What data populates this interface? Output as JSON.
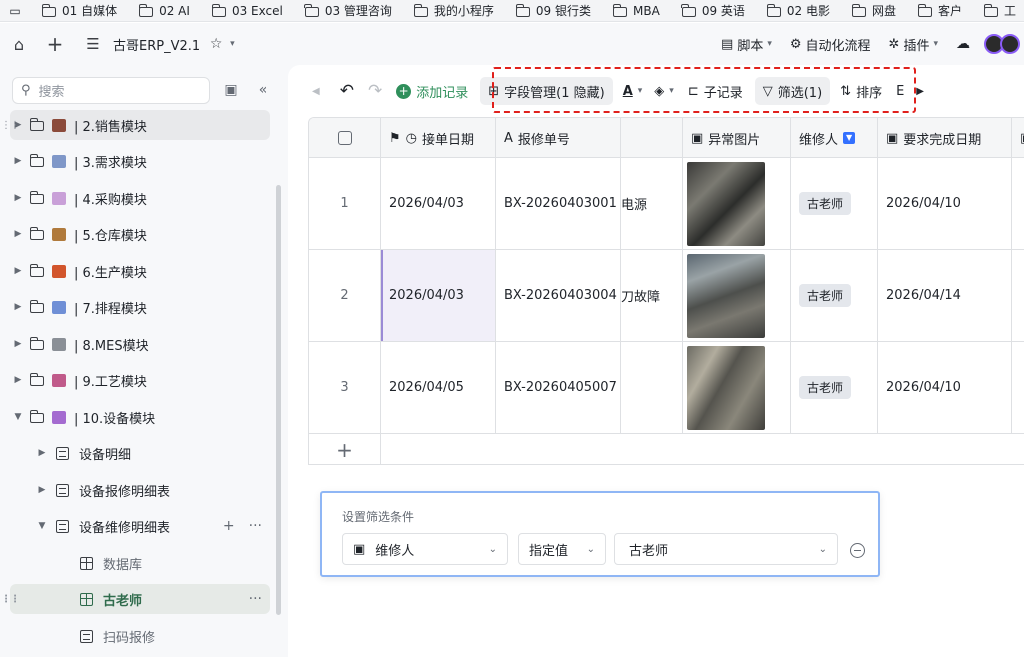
{
  "bookmarks": [
    "01 自媒体",
    "02 AI",
    "03 Excel",
    "03 管理咨询",
    "我的小程序",
    "09 银行类",
    "MBA",
    "09 英语",
    "02 电影",
    "网盘",
    "客户",
    "工"
  ],
  "app": {
    "title": "古哥ERP_V2.1",
    "header_buttons": {
      "script": "脚本",
      "automation": "自动化流程",
      "plugins": "插件"
    }
  },
  "sidebar": {
    "search_placeholder": "搜索",
    "modules": [
      {
        "label": "| 2.销售模块",
        "color": "#8b4a3a"
      },
      {
        "label": "| 3.需求模块",
        "color": "#7f97c8"
      },
      {
        "label": "| 4.采购模块",
        "color": "#c9a0d8"
      },
      {
        "label": "| 5.仓库模块",
        "color": "#b07a3c"
      },
      {
        "label": "| 6.生产模块",
        "color": "#d2552c"
      },
      {
        "label": "| 7.排程模块",
        "color": "#6f8fd6"
      },
      {
        "label": "| 8.MES模块",
        "color": "#8a8f96"
      },
      {
        "label": "| 9.工艺模块",
        "color": "#c05a8a"
      },
      {
        "label": "| 10.设备模块",
        "color": "#a46bd0"
      }
    ],
    "children": [
      "设备明细",
      "设备报修明细表",
      "设备维修明细表"
    ],
    "views": [
      "数据库",
      "古老师"
    ],
    "last_item": "扫码报修"
  },
  "toolbar": {
    "add_record": "添加记录",
    "field_mgmt": "字段管理(1 隐藏)",
    "sub_record": "子记录",
    "filter": "筛选(1)",
    "sort": "排序"
  },
  "table": {
    "headers": [
      "接单日期",
      "报修单号",
      "",
      "异常图片",
      "维修人",
      "要求完成日期"
    ],
    "rows": [
      {
        "no": "1",
        "date": "2026/04/03",
        "order": "BX-20260403001",
        "desc": "电源",
        "person": "古老师",
        "due": "2026/04/10"
      },
      {
        "no": "2",
        "date": "2026/04/03",
        "order": "BX-20260403004",
        "desc": "刀故障",
        "person": "古老师",
        "due": "2026/04/14"
      },
      {
        "no": "3",
        "date": "2026/04/05",
        "order": "BX-20260405007",
        "desc": "",
        "person": "古老师",
        "due": "2026/04/10"
      }
    ]
  },
  "filter_panel": {
    "title": "设置筛选条件",
    "field": "维修人",
    "operator": "指定值",
    "value": "古老师"
  },
  "colors": {
    "accent": "#2f8f5b",
    "selected_view": "#2f6b4c",
    "highlight_border": "#e0201c",
    "filter_border": "#8fb6f5"
  }
}
